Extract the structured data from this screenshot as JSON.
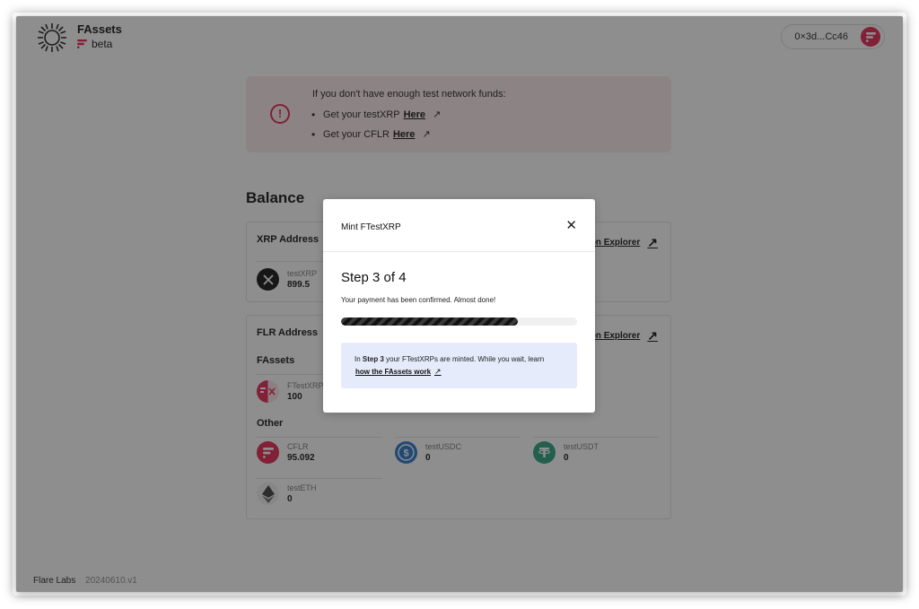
{
  "header": {
    "brand_name": "FAssets",
    "brand_sub": "beta",
    "wallet_address": "0×3d...Cc46",
    "wallet_avatar_icon": "flare-logo-icon"
  },
  "notice": {
    "title": "If you don't have enough test network funds:",
    "items": [
      {
        "prefix": "Get your testXRP",
        "link": "Here"
      },
      {
        "prefix": "Get your CFLR",
        "link": "Here"
      }
    ],
    "icon": "alert-circle-icon"
  },
  "balance": {
    "title": "Balance",
    "xrp_card": {
      "title": "XRP Address",
      "explorer_label": "View on Explorer",
      "asset": {
        "name": "testXRP",
        "amount": "899.5",
        "icon": "xrp-icon"
      }
    },
    "flr_card": {
      "title": "FLR Address",
      "explorer_label": "View on Explorer",
      "fassets_label": "FAssets",
      "fassets": [
        {
          "name": "FTestXRP",
          "amount": "100",
          "icon": "fxrp-icon"
        }
      ],
      "other_label": "Other",
      "other": [
        {
          "name": "CFLR",
          "amount": "95.092",
          "icon": "flare-icon",
          "color": "#e4234f"
        },
        {
          "name": "testUSDC",
          "amount": "0",
          "icon": "usdc-icon",
          "color": "#2775ca"
        },
        {
          "name": "testUSDT",
          "amount": "0",
          "icon": "usdt-icon",
          "color": "#26a17b"
        },
        {
          "name": "testETH",
          "amount": "0",
          "icon": "eth-icon",
          "color": "#3c3c3d"
        }
      ]
    }
  },
  "footer": {
    "company": "Flare Labs",
    "version": "20240610.v1"
  },
  "modal": {
    "title": "Mint FTestXRP",
    "step_title": "Step 3 of 4",
    "step_desc": "Your payment has been confirmed. Almost done!",
    "progress": 0.75,
    "info_prefix": "In",
    "info_bold": "Step 3",
    "info_rest": "your FTestXRPs are minted. While you wait, learn",
    "info_link": "how the FAssets work"
  },
  "colors": {
    "accent": "#e4234f",
    "info_bg": "#e6ebfb",
    "notice_bg": "#fbe9ec"
  }
}
